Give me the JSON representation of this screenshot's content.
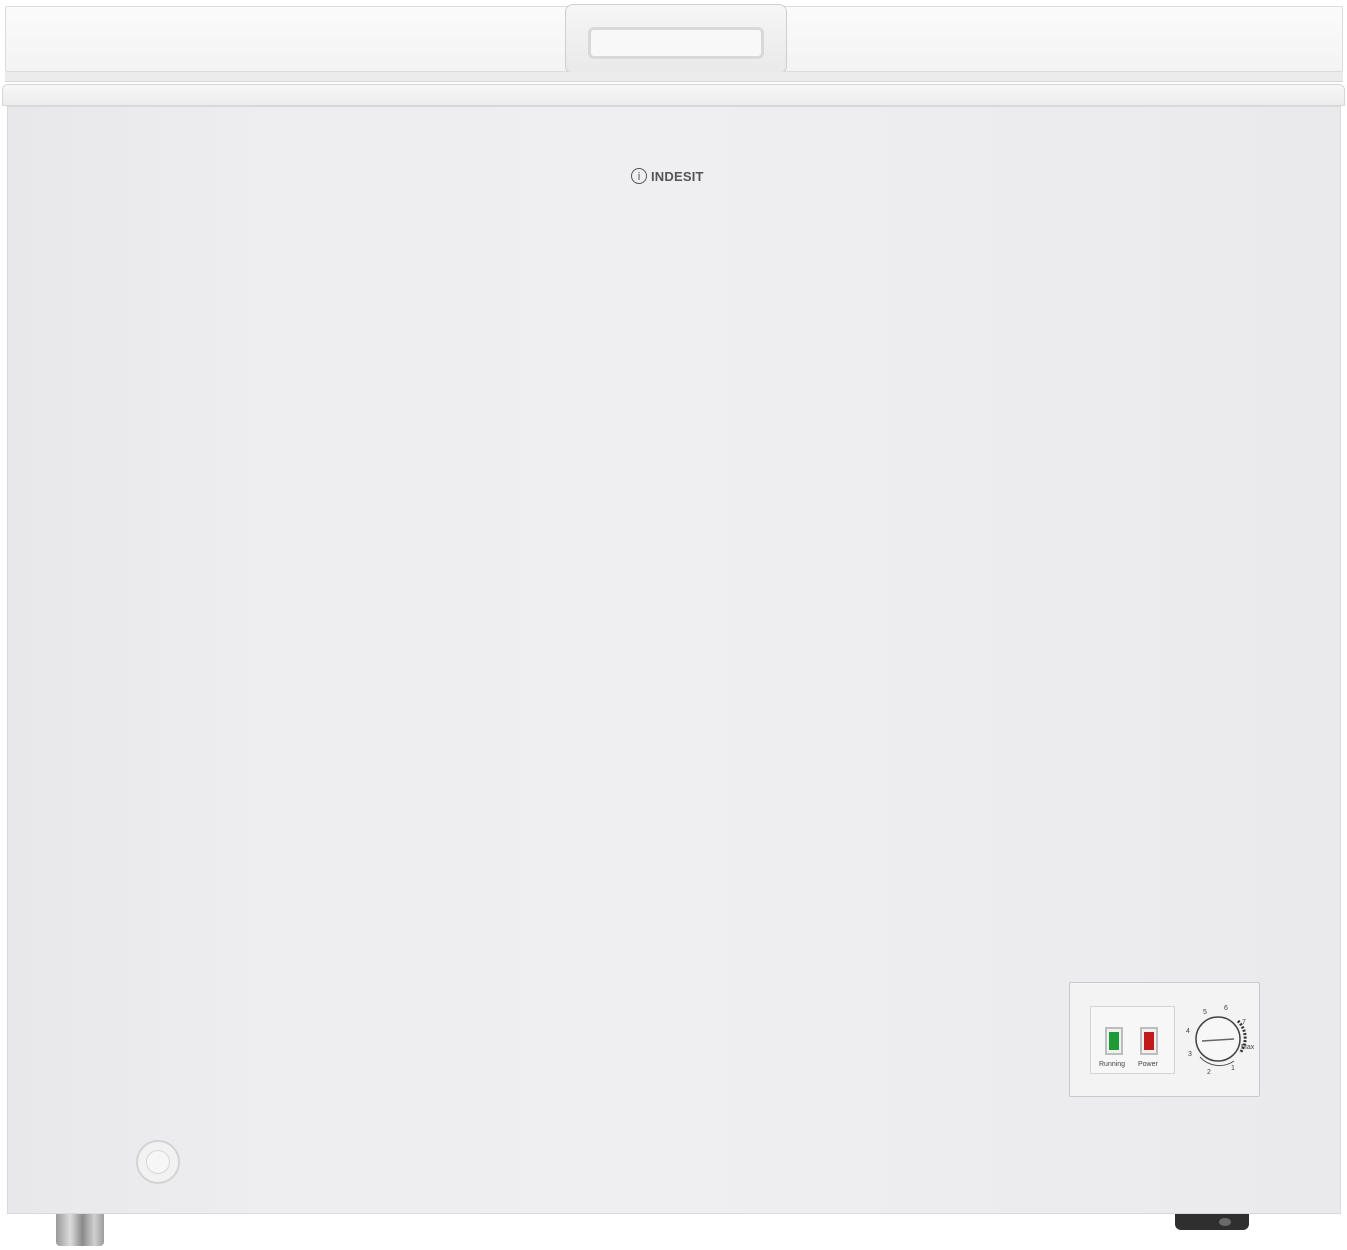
{
  "product": {
    "brand_mark": "i",
    "brand_name": "INDESIT"
  },
  "control_panel": {
    "running_label": "Running",
    "power_label": "Power",
    "running_color": "#1e9a35",
    "power_color": "#c21a1a",
    "dial_numbers": [
      "1",
      "2",
      "3",
      "4",
      "5",
      "6",
      "7"
    ],
    "dial_max_label": "Max"
  },
  "colors": {
    "body": "#efeff1",
    "lid": "#f6f6f6"
  }
}
